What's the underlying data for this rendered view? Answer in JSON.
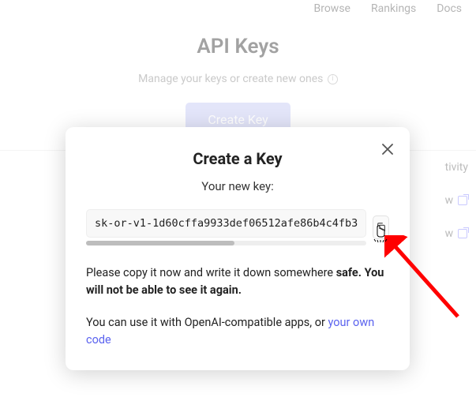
{
  "nav": {
    "browse": "Browse",
    "rankings": "Rankings",
    "docs": "Docs"
  },
  "page": {
    "title": "API Keys",
    "subtitle": "Manage your keys or create new ones",
    "create_button": "Create Key"
  },
  "bg_right": {
    "activity": "tivity",
    "w1": "w",
    "w2": "w"
  },
  "modal": {
    "title": "Create a Key",
    "subheading": "Your new key:",
    "key_value": "sk-or-v1-1d60cffa9933def06512afe86b4c4fb3",
    "message_pre": "Please copy it now and write it down somewhere ",
    "message_safe": "safe.",
    "message_warn": "You will not be able to see it again.",
    "compat_pre": "You can use it with OpenAI-compatible apps, or ",
    "compat_link": "your own code"
  }
}
